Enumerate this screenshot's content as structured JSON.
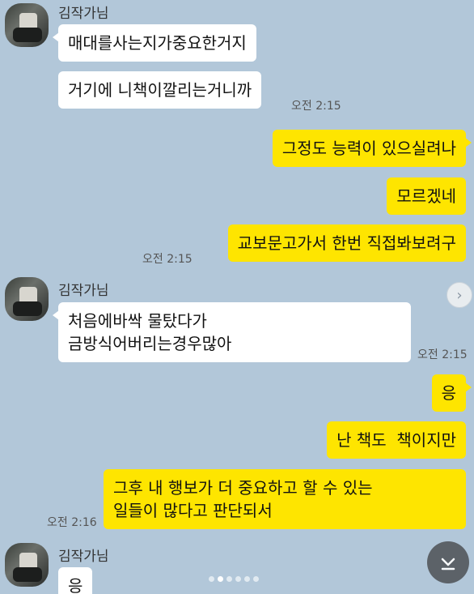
{
  "sender_name": "김작가님",
  "messages": [
    {
      "text": "매대를사는지가중요한거지"
    },
    {
      "text": "거기에 니책이깔리는거니까",
      "time": "오전 2:15"
    },
    {
      "text": "그정도 능력이 있으실려나"
    },
    {
      "text": "모르겠네"
    },
    {
      "text": "교보문고가서 한번 직접봐보려구",
      "time": "오전 2:15"
    },
    {
      "text": "처음에바싹 물탔다가\n금방식어버리는경우많아",
      "time": "오전 2:15"
    },
    {
      "text": "응"
    },
    {
      "text": "난 책도  책이지만"
    },
    {
      "text": "그후 내 행보가 더 중요하고 할 수 있는\n일들이 많다고 판단되서",
      "time": "오전 2:16"
    },
    {
      "text": "응"
    }
  ],
  "icons": {
    "side_arrow": "chevron-right-icon",
    "scroll_down": "arrow-down-to-line-icon"
  },
  "colors": {
    "background": "#b2c7d9",
    "incoming_bubble": "#ffffff",
    "outgoing_bubble": "#fee500"
  }
}
